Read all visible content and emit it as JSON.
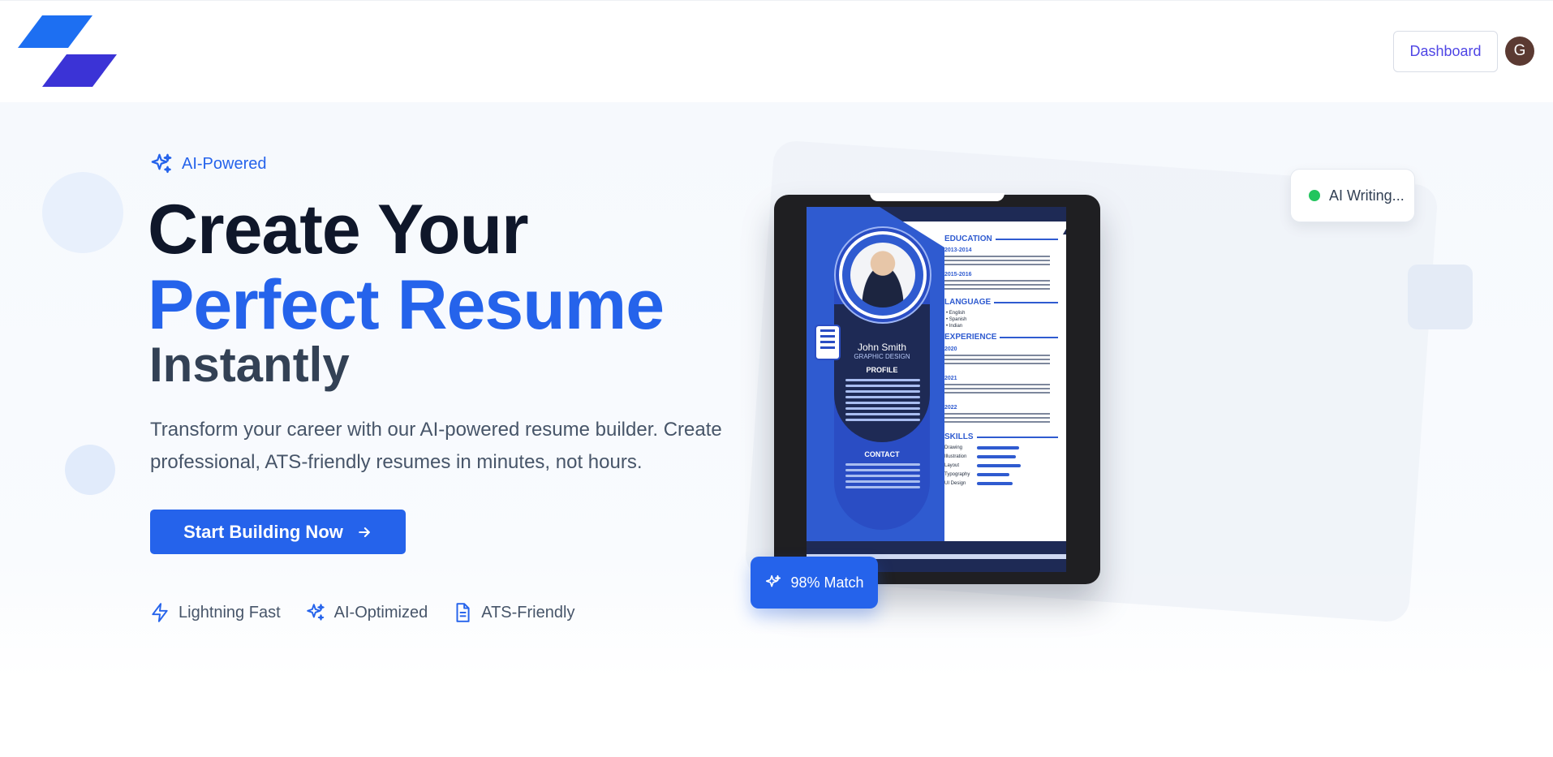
{
  "header": {
    "dashboard_label": "Dashboard",
    "avatar_initial": "G"
  },
  "hero": {
    "badge": "AI-Powered",
    "title_line1": "Create Your",
    "title_line2": "Perfect Resume",
    "title_line3": "Instantly",
    "description": "Transform your career with our AI-powered resume builder. Create professional, ATS-friendly resumes in minutes, not hours.",
    "cta_label": "Start Building Now",
    "features": [
      {
        "label": "Lightning Fast",
        "icon": "lightning-icon"
      },
      {
        "label": "AI-Optimized",
        "icon": "sparkles-icon"
      },
      {
        "label": "ATS-Friendly",
        "icon": "document-icon"
      }
    ]
  },
  "illustration": {
    "status_pill": "AI Writing...",
    "match_badge": "98% Match",
    "resume": {
      "name": "John Smith",
      "role": "GRAPHIC DESIGN",
      "profile_heading": "PROFILE",
      "contact_heading": "CONTACT",
      "education_heading": "EDUCATION",
      "edu_years": [
        "2013-2014",
        "2015-2016"
      ],
      "language_heading": "LANGUAGE",
      "languages": [
        "• English",
        "• Spanish",
        "• Indian"
      ],
      "experience_heading": "EXPERIENCE",
      "exp_years": [
        "2020",
        "2021",
        "2022"
      ],
      "skills_heading": "SKILLS",
      "skills": [
        "Drawing",
        "Illustration",
        "Layout",
        "Typography",
        "UI Design"
      ]
    }
  },
  "colors": {
    "primary": "#2563eb",
    "heading_dark": "#0f172a",
    "subheading": "#334155",
    "status_dot": "#22c55e"
  }
}
